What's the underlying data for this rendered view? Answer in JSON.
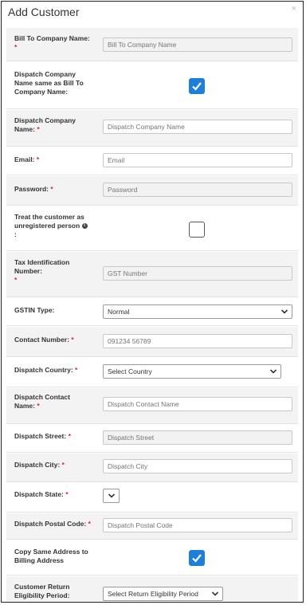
{
  "modal": {
    "title": "Add Customer",
    "close_label": "×"
  },
  "required_mark": "*",
  "fields": {
    "bill_to": {
      "label": "Bill To Company Name:",
      "placeholder": "Bill To Company Name"
    },
    "dispatch_same": {
      "label": "Dispatch Company Name same as Bill To Company Name:",
      "checked": true
    },
    "dispatch_company": {
      "label": "Dispatch Company Name:",
      "placeholder": "Dispatch Company Name"
    },
    "email": {
      "label": "Email:",
      "placeholder": "Email"
    },
    "password": {
      "label": "Password:",
      "placeholder": "Password"
    },
    "unregistered": {
      "label": "Treat the customer as unregistered person",
      "label_end": ":",
      "info_icon": "i",
      "checked": false
    },
    "tax_id": {
      "label": "Tax Identification Number:",
      "placeholder": "GST Number"
    },
    "gstin_type": {
      "label": "GSTIN Type:",
      "value": "Normal"
    },
    "contact_number": {
      "label": "Contact Number:",
      "placeholder": "091234 56789"
    },
    "dispatch_country": {
      "label": "Dispatch Country:",
      "value": "Select Country"
    },
    "dispatch_contact": {
      "label": "Dispatch Contact Name:",
      "placeholder": "Dispatch Contact Name"
    },
    "dispatch_street": {
      "label": "Dispatch Street:",
      "placeholder": "Dispatch Street"
    },
    "dispatch_city": {
      "label": "Dispatch City:",
      "placeholder": "Dispatch City"
    },
    "dispatch_state": {
      "label": "Dispatch State:",
      "value": ""
    },
    "dispatch_postal": {
      "label": "Dispatch Postal Code:",
      "placeholder": "Dispatch Postal Code"
    },
    "copy_billing": {
      "label": "Copy Same Address to Billing Address",
      "checked": true
    },
    "return_period": {
      "label": "Customer Return Eligibility Period:",
      "value": "Select Return Eligibility Period"
    }
  },
  "colors": {
    "accent": "#1c7fd8",
    "required": "#d9262c"
  }
}
